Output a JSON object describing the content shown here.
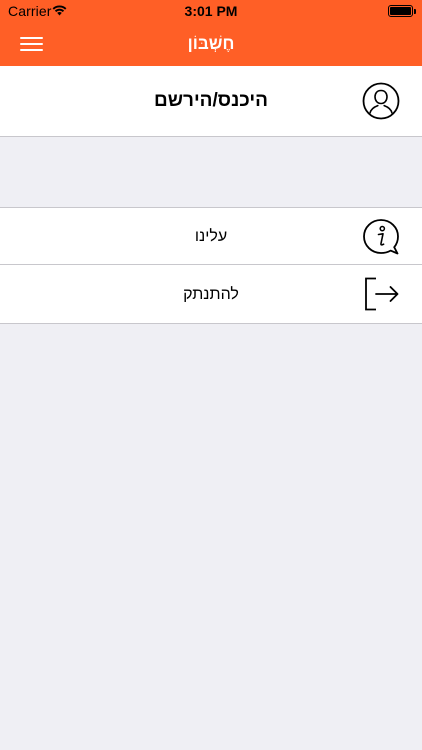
{
  "status_bar": {
    "carrier": "Carrier",
    "time": "3:01 PM"
  },
  "nav": {
    "title": "חֶשְׁבּוֹן"
  },
  "menu": {
    "login_label": "היכנס/הירשם",
    "about_label": "עלינו",
    "logout_label": "להתנתק"
  },
  "icons": {
    "menu": "hamburger-menu-icon",
    "login": "user-profile-icon",
    "about": "info-icon",
    "logout": "logout-arrow-icon",
    "wifi": "wifi-icon",
    "battery": "battery-icon"
  },
  "colors": {
    "accent": "#ff5f26",
    "background": "#efeff4",
    "separator": "#c8c7cc"
  }
}
